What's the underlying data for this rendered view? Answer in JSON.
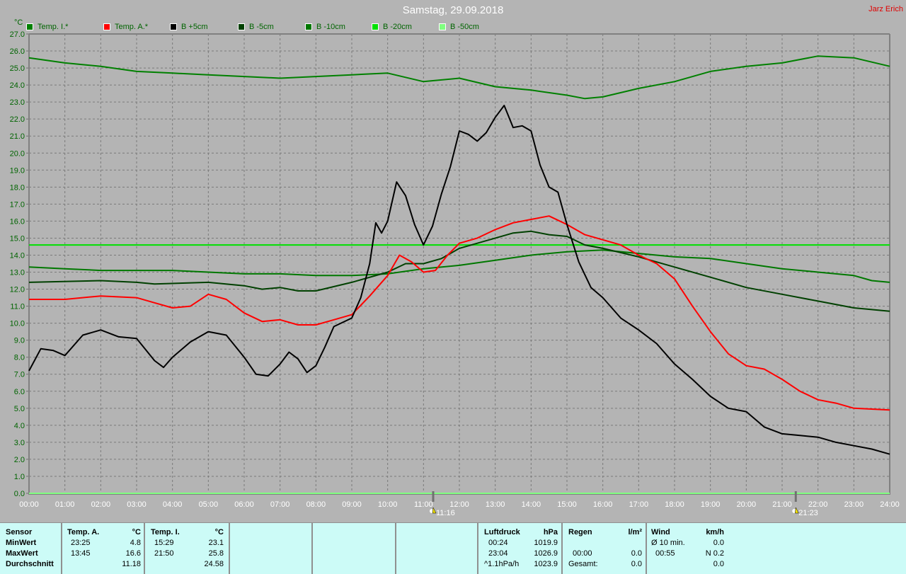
{
  "title": "Samstag, 29.09.2018",
  "author": "Jarz Erich",
  "chart_data": {
    "type": "line",
    "title": "Samstag, 29.09.2018",
    "ylabel": "°C",
    "xlabel": "",
    "ylim": [
      0,
      27
    ],
    "xlim_hours": [
      0,
      24
    ],
    "grid": true,
    "legend_position": "top",
    "y_ticks": [
      "0.0",
      "1.0",
      "2.0",
      "3.0",
      "4.0",
      "5.0",
      "6.0",
      "7.0",
      "8.0",
      "9.0",
      "10.0",
      "11.0",
      "12.0",
      "13.0",
      "14.0",
      "15.0",
      "16.0",
      "17.0",
      "18.0",
      "19.0",
      "20.0",
      "21.0",
      "22.0",
      "23.0",
      "24.0",
      "25.0",
      "26.0",
      "27.0"
    ],
    "x_ticks": [
      "00:00",
      "01:00",
      "02:00",
      "03:00",
      "04:00",
      "05:00",
      "06:00",
      "07:00",
      "08:00",
      "09:00",
      "10:00",
      "11:00",
      "12:00",
      "13:00",
      "14:00",
      "15:00",
      "16:00",
      "17:00",
      "18:00",
      "19:00",
      "20:00",
      "21:00",
      "22:00",
      "23:00",
      "24:00"
    ],
    "markers": [
      {
        "label": "11:16",
        "hour": 11.27,
        "icon": "sunrise-icon"
      },
      {
        "label": "21:23",
        "hour": 21.38,
        "icon": "sunset-icon"
      }
    ],
    "series": [
      {
        "name": "Temp. I.*",
        "color": "#008000",
        "x": [
          0,
          1,
          2,
          3,
          4,
          5,
          6,
          7,
          8,
          9,
          10,
          11,
          12,
          13,
          14,
          15,
          15.5,
          16,
          17,
          18,
          19,
          20,
          21,
          22,
          23,
          24
        ],
        "y": [
          25.6,
          25.3,
          25.1,
          24.8,
          24.7,
          24.6,
          24.5,
          24.4,
          24.5,
          24.6,
          24.7,
          24.2,
          24.4,
          23.9,
          23.7,
          23.4,
          23.2,
          23.3,
          23.8,
          24.2,
          24.8,
          25.1,
          25.3,
          25.7,
          25.6,
          25.1
        ]
      },
      {
        "name": "Temp. A.*",
        "color": "#ff0000",
        "x": [
          0,
          1,
          2,
          3,
          3.5,
          4,
          4.5,
          5,
          5.5,
          6,
          6.5,
          7,
          7.5,
          8,
          8.5,
          9,
          9.5,
          10,
          10.33,
          10.67,
          11,
          11.33,
          11.67,
          12,
          12.5,
          13,
          13.5,
          14,
          14.5,
          15,
          15.5,
          16,
          16.5,
          17,
          17.5,
          18,
          18.5,
          19,
          19.5,
          20,
          20.5,
          21,
          21.5,
          22,
          22.5,
          23,
          24
        ],
        "y": [
          11.4,
          11.4,
          11.6,
          11.5,
          11.2,
          10.9,
          11.0,
          11.7,
          11.4,
          10.6,
          10.1,
          10.2,
          9.9,
          9.9,
          10.2,
          10.5,
          11.6,
          12.8,
          14.0,
          13.6,
          13.0,
          13.1,
          14.0,
          14.7,
          15.0,
          15.5,
          15.9,
          16.1,
          16.3,
          15.8,
          15.2,
          14.9,
          14.6,
          14.0,
          13.5,
          12.6,
          11.0,
          9.5,
          8.2,
          7.5,
          7.3,
          6.7,
          6.0,
          5.5,
          5.3,
          5.0,
          4.9
        ]
      },
      {
        "name": "B +5cm",
        "color": "#000000",
        "x": [
          0,
          0.33,
          0.67,
          1,
          1.5,
          2,
          2.5,
          3,
          3.5,
          3.75,
          4,
          4.5,
          5,
          5.5,
          6,
          6.33,
          6.67,
          7,
          7.25,
          7.5,
          7.75,
          8,
          8.25,
          8.5,
          9,
          9.25,
          9.5,
          9.67,
          9.83,
          10,
          10.25,
          10.5,
          10.75,
          11,
          11.25,
          11.5,
          11.75,
          12,
          12.25,
          12.5,
          12.75,
          13,
          13.25,
          13.5,
          13.75,
          14,
          14.25,
          14.5,
          14.75,
          15,
          15.33,
          15.67,
          16,
          16.5,
          17,
          17.5,
          18,
          18.5,
          19,
          19.5,
          20,
          20.5,
          21,
          21.5,
          22,
          22.5,
          23,
          23.5,
          24
        ],
        "y": [
          7.2,
          8.5,
          8.4,
          8.1,
          9.3,
          9.6,
          9.2,
          9.1,
          7.8,
          7.4,
          8.0,
          8.9,
          9.5,
          9.3,
          8.0,
          7.0,
          6.9,
          7.6,
          8.3,
          7.9,
          7.1,
          7.5,
          8.6,
          9.8,
          10.3,
          11.5,
          13.5,
          15.9,
          15.3,
          16.0,
          18.3,
          17.5,
          15.8,
          14.6,
          15.7,
          17.6,
          19.2,
          21.3,
          21.1,
          20.7,
          21.2,
          22.1,
          22.8,
          21.5,
          21.6,
          21.3,
          19.3,
          18.0,
          17.7,
          15.8,
          13.6,
          12.1,
          11.5,
          10.3,
          9.6,
          8.8,
          7.6,
          6.7,
          5.7,
          5.0,
          4.8,
          3.9,
          3.5,
          3.4,
          3.3,
          3.0,
          2.8,
          2.6,
          2.3
        ]
      },
      {
        "name": "B -5cm",
        "color": "#004000",
        "x": [
          0,
          2,
          3,
          3.5,
          5,
          6,
          6.5,
          7,
          7.5,
          8,
          9,
          10,
          10.5,
          11,
          11.5,
          12,
          12.5,
          13,
          13.5,
          14,
          14.5,
          15,
          15.5,
          16,
          17,
          18,
          19,
          20,
          21,
          22,
          23,
          24
        ],
        "y": [
          12.4,
          12.5,
          12.4,
          12.3,
          12.4,
          12.2,
          12.0,
          12.1,
          11.9,
          11.9,
          12.4,
          13.0,
          13.5,
          13.5,
          13.8,
          14.4,
          14.7,
          15.0,
          15.3,
          15.4,
          15.2,
          15.1,
          14.6,
          14.4,
          13.9,
          13.3,
          12.7,
          12.1,
          11.7,
          11.3,
          10.9,
          10.7
        ]
      },
      {
        "name": "B -10cm",
        "color": "#007800",
        "x": [
          0,
          1,
          2,
          4,
          5,
          6,
          7,
          8,
          9,
          10,
          11,
          12,
          13,
          14,
          15,
          16,
          17,
          18,
          19,
          20,
          21,
          22,
          23,
          23.5,
          24
        ],
        "y": [
          13.3,
          13.2,
          13.1,
          13.1,
          13.0,
          12.9,
          12.9,
          12.8,
          12.8,
          12.9,
          13.2,
          13.4,
          13.7,
          14.0,
          14.2,
          14.3,
          14.1,
          13.9,
          13.8,
          13.5,
          13.2,
          13.0,
          12.8,
          12.5,
          12.4
        ]
      },
      {
        "name": "B -20cm",
        "color": "#00e000",
        "x": [
          0,
          24
        ],
        "y": [
          14.6,
          14.6
        ]
      },
      {
        "name": "B -50cm",
        "color": "#80ff80",
        "x": [
          0,
          24
        ],
        "y": [
          0,
          0
        ]
      }
    ]
  },
  "table": {
    "sensor": {
      "header": "Sensor",
      "rows": [
        "MinWert",
        "MaxWert",
        "Durchschnitt"
      ]
    },
    "temp_a": {
      "header": "Temp. A.",
      "unit": "°C",
      "min_time": "23:25",
      "min": "4.8",
      "max_time": "13:45",
      "max": "16.6",
      "avg": "11.18"
    },
    "temp_i": {
      "header": "Temp. I.",
      "unit": "°C",
      "min_time": "15:29",
      "min": "23.1",
      "max_time": "21:50",
      "max": "25.8",
      "avg": "24.58"
    },
    "luftdruck": {
      "header": "Luftdruck",
      "unit": "hPa",
      "min_time": "00:24",
      "min": "1019.9",
      "max_time": "23:04",
      "max": "1026.9",
      "trend": "^1.1hPa/h",
      "current": "1023.9"
    },
    "regen": {
      "header": "Regen",
      "unit": "l/m²",
      "max_time": "00:00",
      "max": "0.0",
      "total_label": "Gesamt:",
      "total": "0.0"
    },
    "wind": {
      "header": "Wind",
      "unit": "km/h",
      "avg_label": "Ø 10 min.",
      "avg": "0.0",
      "max_time": "00:55",
      "max": "N 0.2",
      "current": "0.0"
    }
  }
}
